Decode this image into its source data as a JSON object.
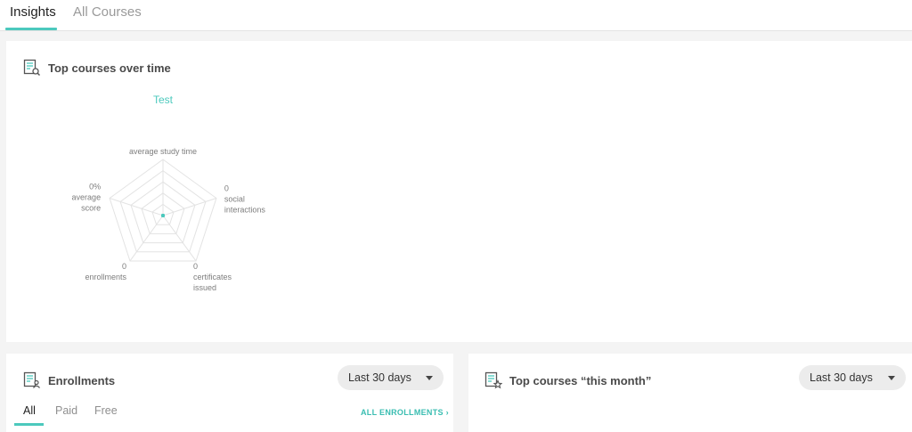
{
  "tabs": [
    {
      "label": "Insights",
      "active": true
    },
    {
      "label": "All Courses",
      "active": false
    }
  ],
  "top_courses_card": {
    "title": "Top courses over time",
    "icon": "document-search-icon"
  },
  "chart_data": {
    "type": "radar",
    "series": [
      {
        "name": "Test",
        "color": "#4cc9bd",
        "values": [
          0,
          0,
          0,
          0,
          0
        ]
      }
    ],
    "axes": [
      {
        "label": "average study time",
        "value_text": ""
      },
      {
        "label": "social interactions",
        "value_text": "0"
      },
      {
        "label": "certificates issued",
        "value_text": "0"
      },
      {
        "label": "enrollments",
        "value_text": "0"
      },
      {
        "label": "average score",
        "value_text": "0%"
      }
    ],
    "legend": "Test",
    "rings": 5
  },
  "enrollments_card": {
    "title": "Enrollments",
    "icon": "document-user-icon",
    "period": "Last 30 days",
    "subtabs": [
      {
        "label": "All",
        "active": true
      },
      {
        "label": "Paid",
        "active": false
      },
      {
        "label": "Free",
        "active": false
      }
    ],
    "link": "ALL ENROLLMENTS ›"
  },
  "top_month_card": {
    "title": "Top courses “this month”",
    "icon": "document-star-icon",
    "period": "Last 30 days"
  },
  "colors": {
    "accent": "#4cc9bd",
    "background": "#f4f4f4",
    "card": "#ffffff"
  }
}
